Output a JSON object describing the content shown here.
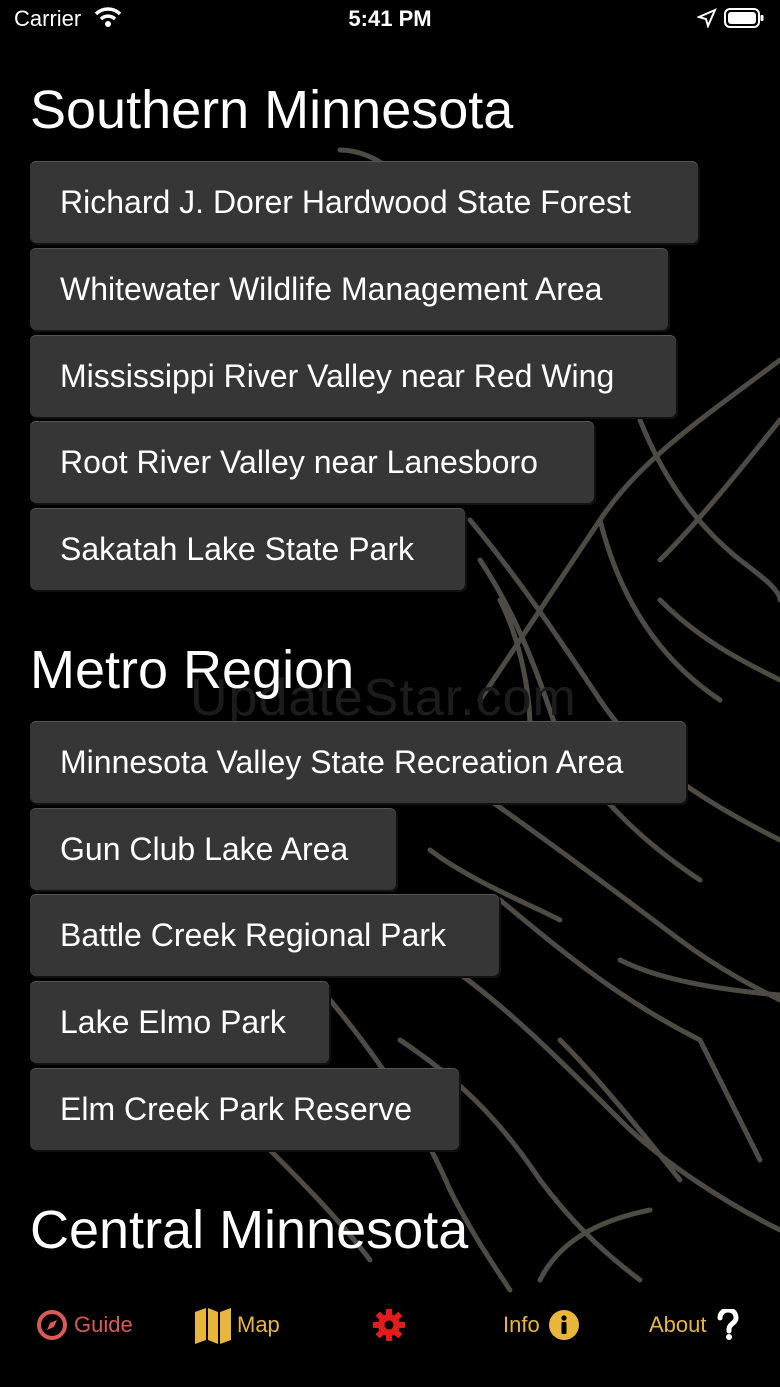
{
  "status_bar": {
    "carrier": "Carrier",
    "time": "5:41 PM"
  },
  "watermark": "UpdateStar.com",
  "sections": [
    {
      "title": "Southern Minnesota",
      "items": [
        "Richard J. Dorer Hardwood State Forest",
        "Whitewater Wildlife Management Area",
        "Mississippi River Valley near Red Wing",
        "Root River Valley near Lanesboro",
        "Sakatah Lake State Park"
      ]
    },
    {
      "title": "Metro Region",
      "items": [
        "Minnesota Valley State Recreation Area",
        "Gun Club Lake Area",
        "Battle Creek Regional Park",
        "Lake Elmo Park",
        "Elm Creek Park Reserve"
      ]
    },
    {
      "title": "Central Minnesota",
      "items": []
    }
  ],
  "tabs": [
    {
      "label": "Guide",
      "icon": "compass-icon",
      "color": "#d85b57"
    },
    {
      "label": "Map",
      "icon": "map-icon",
      "color": "#e8b63a"
    },
    {
      "label": "",
      "icon": "gear-icon",
      "color": "#e41b1b"
    },
    {
      "label": "Info",
      "icon": "info-icon",
      "color": "#e8b63a"
    },
    {
      "label": "About",
      "icon": "question-icon",
      "color": "#e8b63a"
    }
  ]
}
